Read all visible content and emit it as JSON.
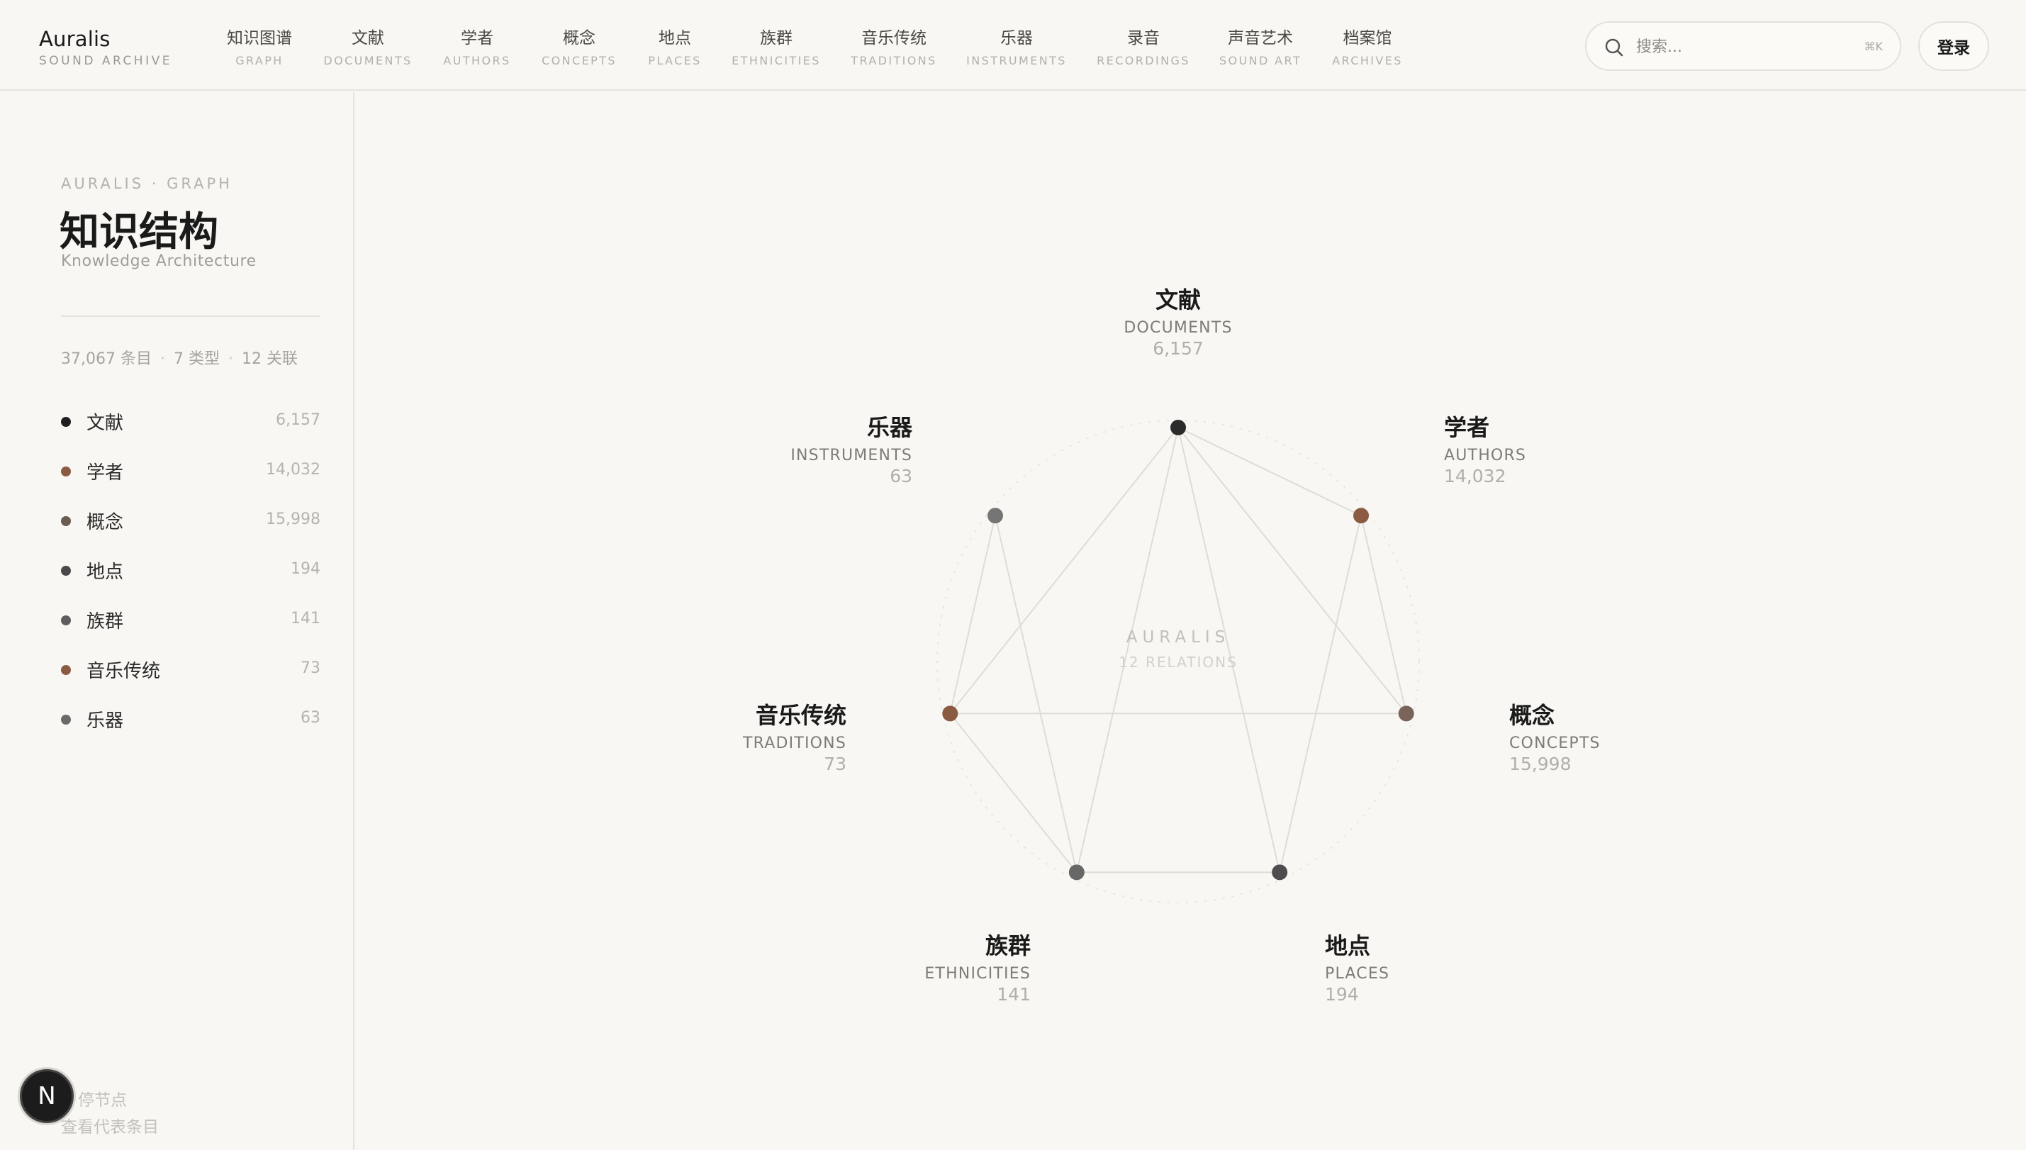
{
  "brand": {
    "name": "Auralis",
    "subtitle": "SOUND ARCHIVE"
  },
  "nav": [
    {
      "zh": "知识图谱",
      "en": "GRAPH"
    },
    {
      "zh": "文献",
      "en": "DOCUMENTS"
    },
    {
      "zh": "学者",
      "en": "AUTHORS"
    },
    {
      "zh": "概念",
      "en": "CONCEPTS"
    },
    {
      "zh": "地点",
      "en": "PLACES"
    },
    {
      "zh": "族群",
      "en": "ETHNICITIES"
    },
    {
      "zh": "音乐传统",
      "en": "TRADITIONS"
    },
    {
      "zh": "乐器",
      "en": "INSTRUMENTS"
    },
    {
      "zh": "录音",
      "en": "RECORDINGS"
    },
    {
      "zh": "声音艺术",
      "en": "SOUND ART"
    },
    {
      "zh": "档案馆",
      "en": "ARCHIVES"
    }
  ],
  "search": {
    "placeholder": "搜索...",
    "shortcut": "⌘K"
  },
  "login_label": "登录",
  "sidebar": {
    "kicker": "AURALIS · GRAPH",
    "title": "知识结构",
    "subtitle": "Knowledge Architecture",
    "stats": {
      "entries": "37,067 条目",
      "types": "7 类型",
      "relations": "12 关联"
    },
    "items": [
      {
        "label": "文献",
        "count": "6,157",
        "color": "#1f1f1f"
      },
      {
        "label": "学者",
        "count": "14,032",
        "color": "#8b5a43"
      },
      {
        "label": "概念",
        "count": "15,998",
        "color": "#6d5a50"
      },
      {
        "label": "地点",
        "count": "194",
        "color": "#4a4a4a"
      },
      {
        "label": "族群",
        "count": "141",
        "color": "#5e5e5e"
      },
      {
        "label": "音乐传统",
        "count": "73",
        "color": "#8b5a43"
      },
      {
        "label": "乐器",
        "count": "63",
        "color": "#6a6a6a"
      }
    ],
    "hint_line1": "停节点",
    "hint_line2": "查看代表条目",
    "avatar_letter": "N"
  },
  "graph": {
    "center_title": "AURALIS",
    "center_sub": "12 RELATIONS",
    "nodes": [
      {
        "id": "documents",
        "zh": "文献",
        "en": "DOCUMENTS",
        "count": "6,157",
        "color": "#2b2b2b"
      },
      {
        "id": "authors",
        "zh": "学者",
        "en": "AUTHORS",
        "count": "14,032",
        "color": "#8b5a43"
      },
      {
        "id": "concepts",
        "zh": "概念",
        "en": "CONCEPTS",
        "count": "15,998",
        "color": "#7a6358"
      },
      {
        "id": "places",
        "zh": "地点",
        "en": "PLACES",
        "count": "194",
        "color": "#4d4d4d"
      },
      {
        "id": "ethnicities",
        "zh": "族群",
        "en": "ETHNICITIES",
        "count": "141",
        "color": "#676767"
      },
      {
        "id": "traditions",
        "zh": "音乐传统",
        "en": "TRADITIONS",
        "count": "73",
        "color": "#8b5a43"
      },
      {
        "id": "instruments",
        "zh": "乐器",
        "en": "INSTRUMENTS",
        "count": "63",
        "color": "#757575"
      }
    ],
    "edges": [
      [
        "documents",
        "authors"
      ],
      [
        "documents",
        "concepts"
      ],
      [
        "documents",
        "places"
      ],
      [
        "documents",
        "ethnicities"
      ],
      [
        "documents",
        "traditions"
      ],
      [
        "authors",
        "concepts"
      ],
      [
        "authors",
        "places"
      ],
      [
        "concepts",
        "traditions"
      ],
      [
        "places",
        "ethnicities"
      ],
      [
        "ethnicities",
        "traditions"
      ],
      [
        "ethnicities",
        "instruments"
      ],
      [
        "traditions",
        "instruments"
      ]
    ]
  }
}
